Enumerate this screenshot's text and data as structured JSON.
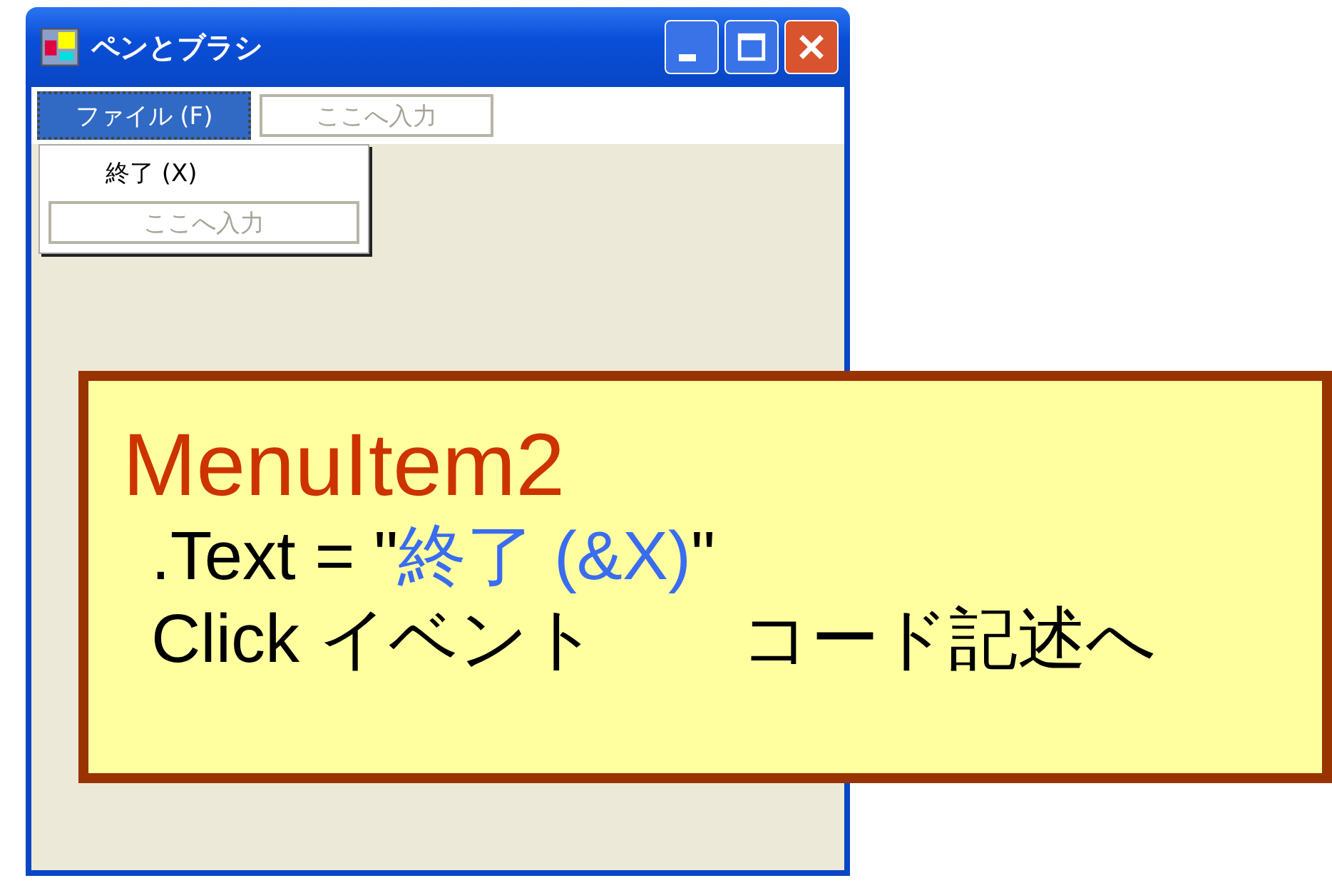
{
  "window": {
    "title": "ペンとブラシ"
  },
  "menu_bar": {
    "items": [
      {
        "label": "ファイル (F)",
        "kind": "menu",
        "selected": true
      },
      {
        "label": "ここへ入力",
        "kind": "type_here",
        "selected": false
      }
    ]
  },
  "dropdown": {
    "items": [
      {
        "label": "終了 (X)",
        "kind": "item"
      },
      {
        "label": "ここへ入力",
        "kind": "type_here"
      }
    ]
  },
  "callout": {
    "title": "MenuItem2",
    "property_line": {
      "prefix": ".Text = \"",
      "value": "終了 (&X)",
      "suffix": "\""
    },
    "event_line": {
      "label": "Click イベント",
      "action": "コード記述へ"
    }
  }
}
